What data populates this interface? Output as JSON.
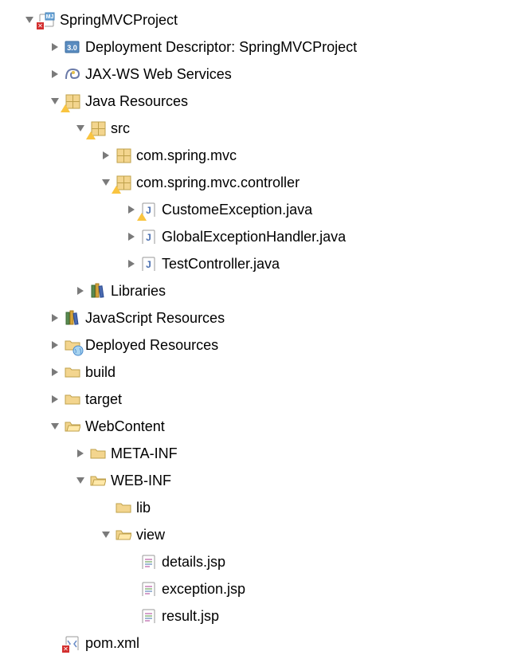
{
  "tree": {
    "root": {
      "label": "SpringMVCProject"
    },
    "deployDesc": {
      "label": "Deployment Descriptor: SpringMVCProject"
    },
    "jaxws": {
      "label": "JAX-WS Web Services"
    },
    "javaRes": {
      "label": "Java Resources"
    },
    "src": {
      "label": "src"
    },
    "pkgMvc": {
      "label": "com.spring.mvc"
    },
    "pkgCtrl": {
      "label": "com.spring.mvc.controller"
    },
    "custEx": {
      "label": "CustomeException.java"
    },
    "globalEx": {
      "label": "GlobalExceptionHandler.java"
    },
    "testCtrl": {
      "label": "TestController.java"
    },
    "libraries": {
      "label": "Libraries"
    },
    "jsRes": {
      "label": "JavaScript Resources"
    },
    "deployedRes": {
      "label": "Deployed Resources"
    },
    "build": {
      "label": "build"
    },
    "target": {
      "label": "target"
    },
    "webContent": {
      "label": "WebContent"
    },
    "metaInf": {
      "label": "META-INF"
    },
    "webInf": {
      "label": "WEB-INF"
    },
    "lib": {
      "label": "lib"
    },
    "view": {
      "label": "view"
    },
    "detailsJsp": {
      "label": "details.jsp"
    },
    "exceptionJsp": {
      "label": "exception.jsp"
    },
    "resultJsp": {
      "label": "result.jsp"
    },
    "pom": {
      "label": "pom.xml"
    }
  }
}
